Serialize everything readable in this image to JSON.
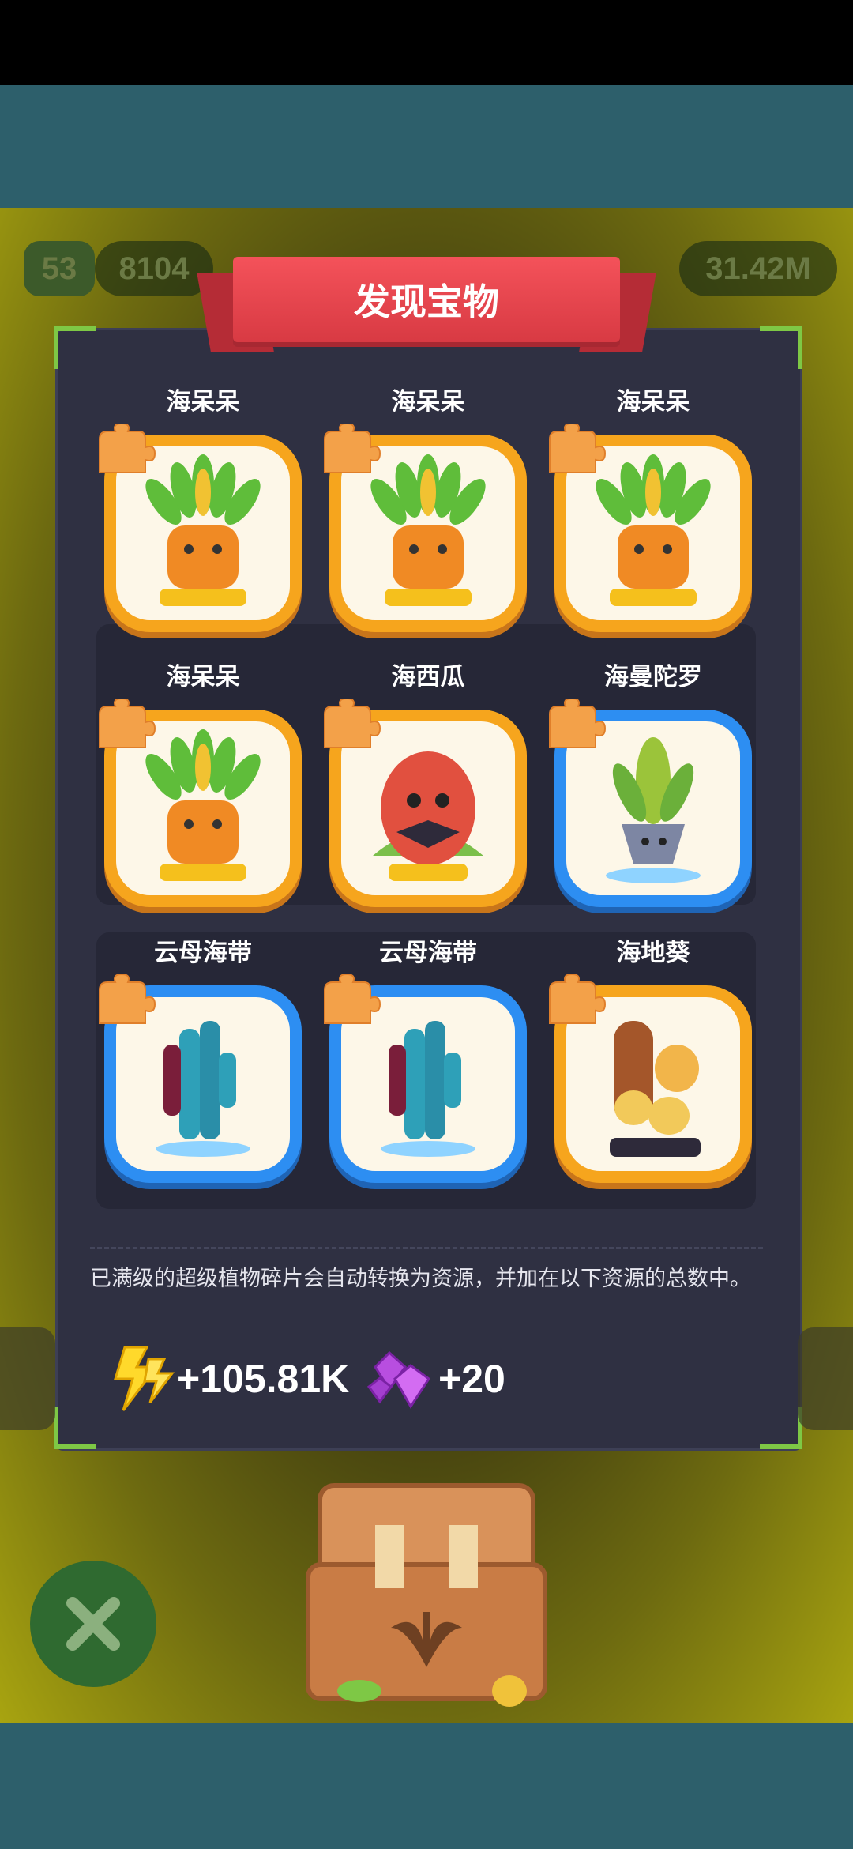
{
  "title": "发现宝物",
  "hud": {
    "level": "53",
    "coins": "8104",
    "energy": "31.42M"
  },
  "cards": [
    {
      "name": "海呆呆",
      "rarity": "gold",
      "plant": "pineapple"
    },
    {
      "name": "海呆呆",
      "rarity": "gold",
      "plant": "pineapple"
    },
    {
      "name": "海呆呆",
      "rarity": "gold",
      "plant": "pineapple"
    },
    {
      "name": "海呆呆",
      "rarity": "gold",
      "plant": "pineapple"
    },
    {
      "name": "海西瓜",
      "rarity": "gold",
      "plant": "watermelon"
    },
    {
      "name": "海曼陀罗",
      "rarity": "blue",
      "plant": "datura"
    },
    {
      "name": "云母海带",
      "rarity": "blue",
      "plant": "kelp"
    },
    {
      "name": "云母海带",
      "rarity": "blue",
      "plant": "kelp"
    },
    {
      "name": "海地葵",
      "rarity": "gold",
      "plant": "sunflower"
    }
  ],
  "note": "已满级的超级植物碎片会自动转换为资源，并加在以下资源的总数中。",
  "resources": {
    "energy": "+105.81K",
    "gems": "+20"
  },
  "colors": {
    "gold": "#f6a51d",
    "blue": "#2d8ef2",
    "ribbon": "#f4525a",
    "corner": "#7ec845"
  }
}
